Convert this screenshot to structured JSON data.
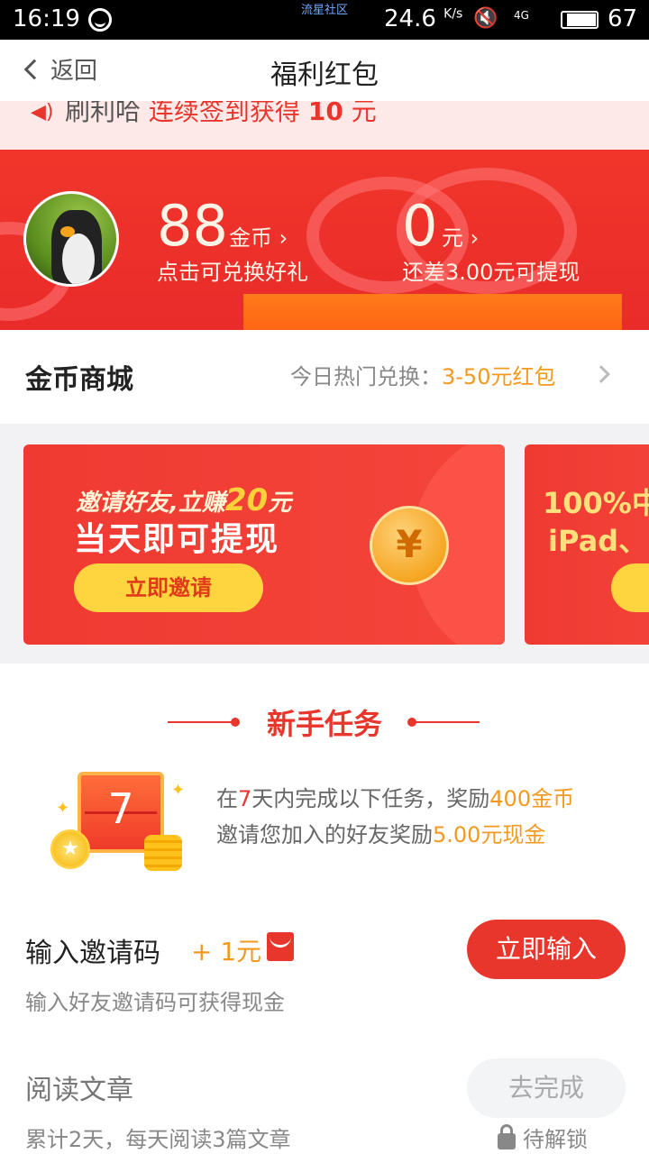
{
  "status_bar": {
    "time": "16:19",
    "watermark": "流星社区",
    "speed": "24.6",
    "speed_unit": "K/s",
    "network": "4G",
    "battery": "67"
  },
  "nav": {
    "back_label": "返回",
    "title": "福利红包"
  },
  "notice": {
    "user": "刷利哈",
    "text": "连续签到获得",
    "amount": "10",
    "unit": "元"
  },
  "account": {
    "coins": "88",
    "coins_unit": "金币",
    "coins_hint": "点击可兑换好礼",
    "cash": "0",
    "cash_unit": "元",
    "cash_hint": "还差3.00元可提现"
  },
  "shop": {
    "title": "金币商城",
    "hint_prefix": "今日热门兑换：",
    "hint_value": "3-50元红包"
  },
  "promo": [
    {
      "line1_prefix": "邀请好友,立赚",
      "line1_amount": "20",
      "line1_suffix": "元",
      "line2": "当天即可提现",
      "button": "立即邀请",
      "coin_symbol": "¥"
    },
    {
      "line1": "100%中",
      "line2": "iPad、"
    }
  ],
  "newbie": {
    "title": "新手任务",
    "calendar_day": "7",
    "desc1": {
      "a": "在",
      "b": "7",
      "c": "天内完成以下任务，奖励",
      "d": "400金币"
    },
    "desc2": {
      "a": "邀请您加入的好友奖励",
      "b": "5.00元现金"
    }
  },
  "tasks": [
    {
      "name": "输入邀请码",
      "reward": "+ 1元",
      "desc": "输入好友邀请码可获得现金",
      "button": "立即输入"
    },
    {
      "name": "阅读文章",
      "desc": "累计2天，每天阅读3篇文章",
      "button": "去完成",
      "status": "待解锁"
    }
  ],
  "colors": {
    "accent": "#e8362d",
    "highlight": "#f29a1f",
    "gold": "#ffd53f"
  }
}
